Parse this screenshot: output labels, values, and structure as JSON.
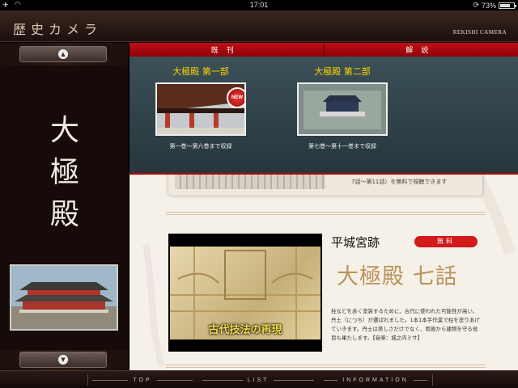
{
  "status_bar": {
    "time": "17:01",
    "battery_text": "73%",
    "battery_level": 0.73
  },
  "header": {
    "app_title": "歴史カメラ",
    "brand": "REKISHI CAMERA"
  },
  "sidebar": {
    "title_chars": [
      "大",
      "極",
      "殿"
    ]
  },
  "tabs": [
    {
      "label": "既刊"
    },
    {
      "label": "解説"
    }
  ],
  "books": [
    {
      "name": "大極殿 第一部",
      "range": "第一巻〜第六巻まで収録",
      "badge": "NEW"
    },
    {
      "name": "大極殿 第二部",
      "range": "第七巻〜第十一巻まで収録"
    }
  ],
  "partial_card": {
    "text": "7話〜第11話）を無料で視聴できます"
  },
  "episode": {
    "location": "平城宮跡",
    "price_badge": "無料",
    "title": "大極殿 七話",
    "video_caption": "古代技法の再現",
    "description": "柱などを赤く塗装するために、古代に使われた可能性が高い、丹土（につち）が選ばれました。1本1本手作業で柱を塗りあげていきます。丹土は美しさだけでなく、雨風から建物を守る役目も果たします。【音楽：城之内ミサ】"
  },
  "bottom_nav": {
    "top": "TOP",
    "list": "LIST",
    "information": "INFORMATION"
  }
}
